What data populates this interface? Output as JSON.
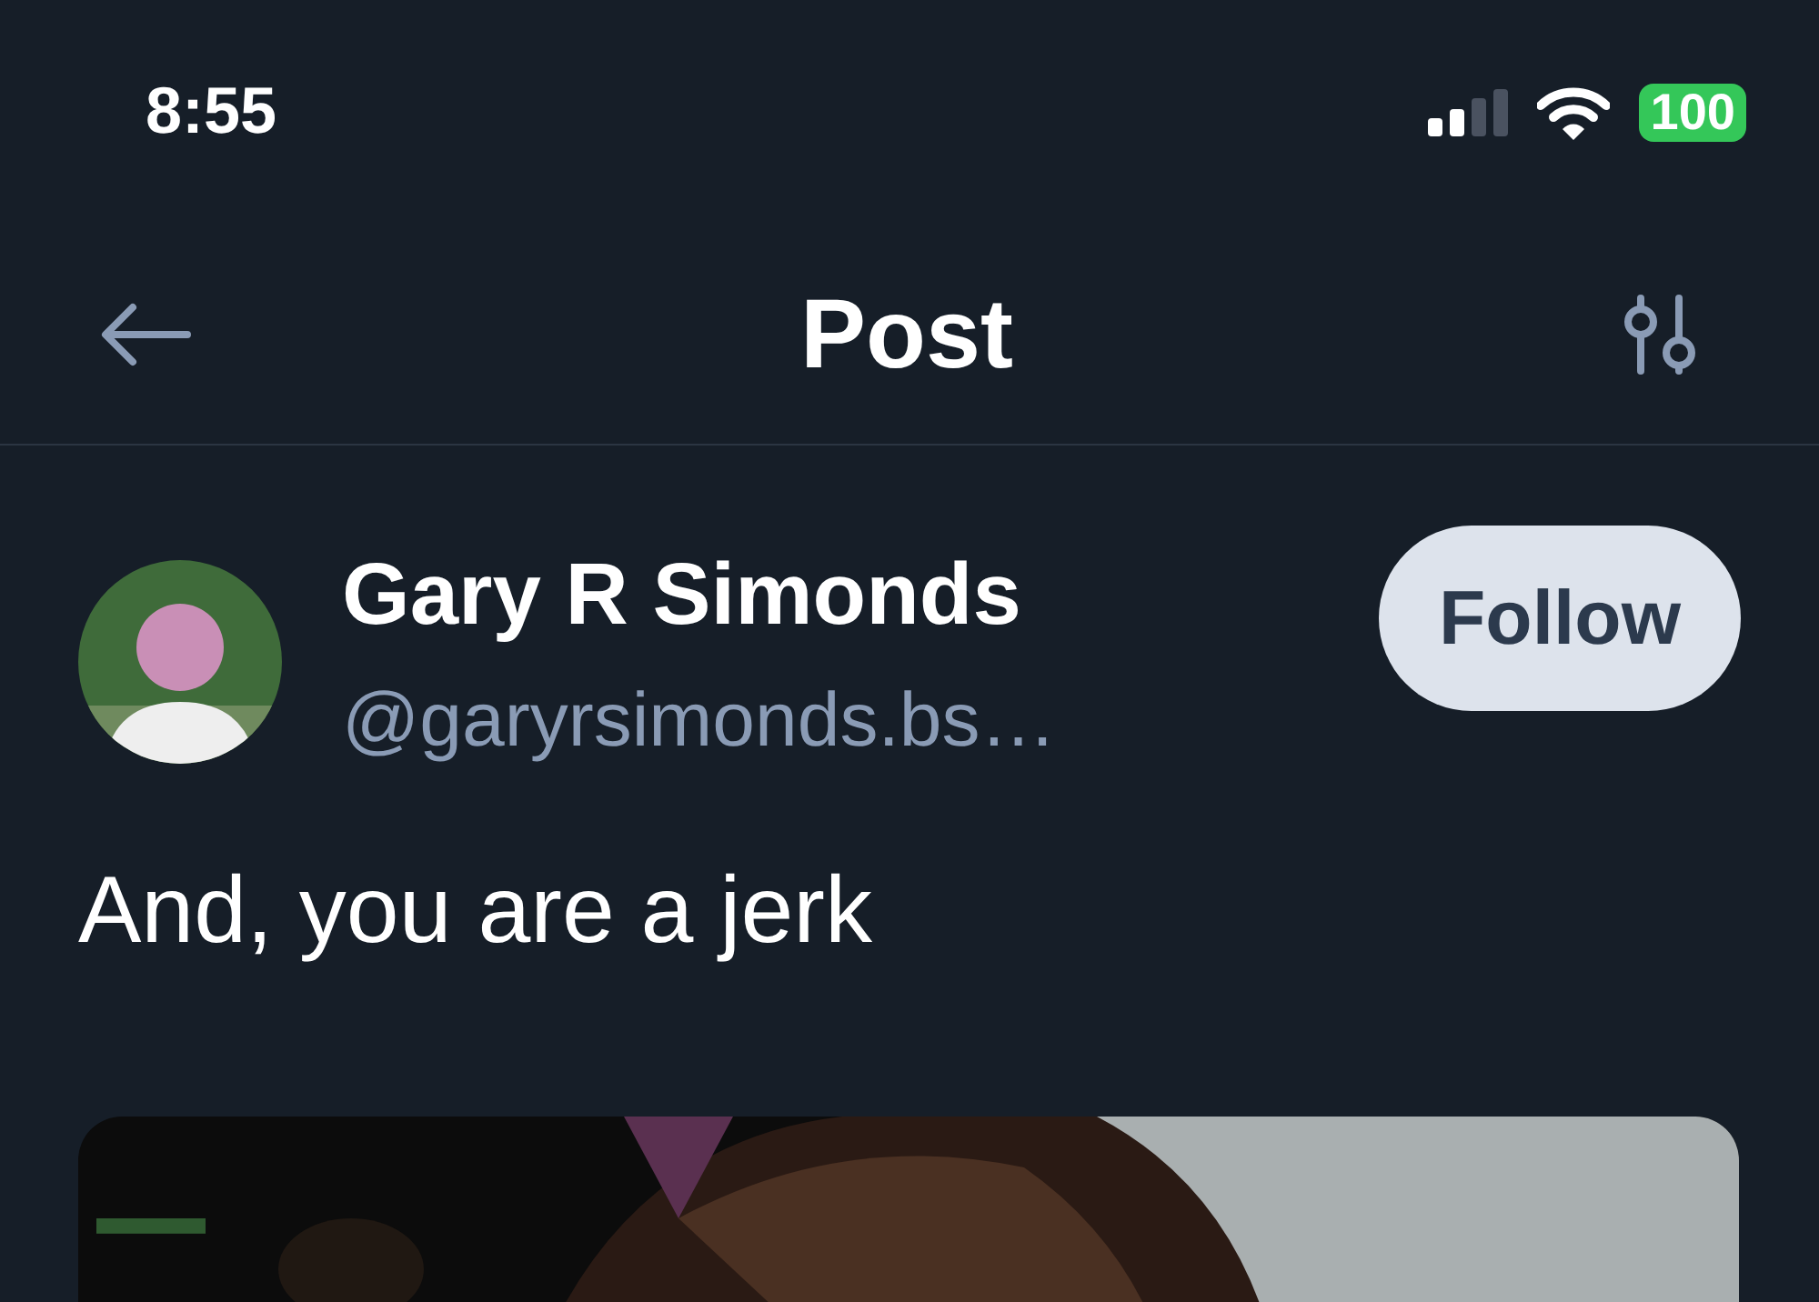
{
  "status_bar": {
    "time": "8:55",
    "battery": "100"
  },
  "header": {
    "title": "Post"
  },
  "post": {
    "author": {
      "name": "Gary R Simonds",
      "handle": "@garyrsimonds.bs…"
    },
    "follow_button": "Follow",
    "text": "And, you are a jerk"
  }
}
